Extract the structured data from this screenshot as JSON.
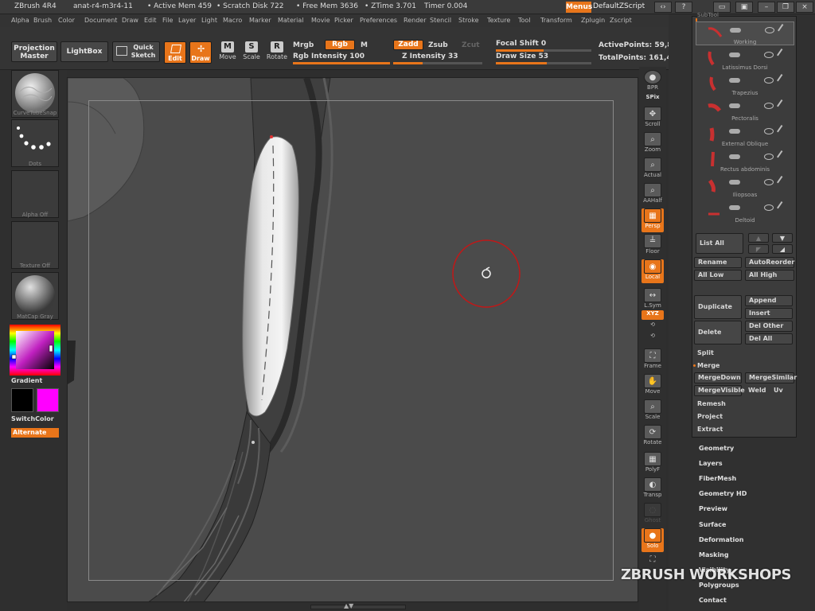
{
  "titlebar": {
    "app": "ZBrush 4R4",
    "doc": "anat-r4-m3r4-11",
    "active_mem": "• Active Mem 459",
    "scratch": "• Scratch Disk 722",
    "free_mem": "• Free Mem 3636",
    "ztime": "• ZTime 3.701",
    "timer": "Timer 0.004",
    "menus": "Menus",
    "zscript": "DefaultZScript"
  },
  "menu": [
    "Alpha",
    "Brush",
    "Color",
    "Document",
    "Draw",
    "Edit",
    "File",
    "Layer",
    "Light",
    "Macro",
    "Marker",
    "Material",
    "Movie",
    "Picker",
    "Preferences",
    "Render",
    "Stencil",
    "Stroke",
    "Texture",
    "Tool",
    "Transform",
    "Zplugin",
    "Zscript"
  ],
  "toolbar": {
    "projection_master": "Projection Master",
    "lightbox": "LightBox",
    "quick_sketch": "Quick Sketch",
    "edit": "Edit",
    "draw": "Draw",
    "move": "Move",
    "scale": "Scale",
    "rotate": "Rotate",
    "mrgb": "Mrgb",
    "rgb": "Rgb",
    "m": "M",
    "rgb_intensity": "Rgb Intensity 100",
    "rgb_intensity_value": 100,
    "zadd": "Zadd",
    "zsub": "Zsub",
    "zcut": "Zcut",
    "z_intensity": "Z Intensity 33",
    "z_intensity_value": 33,
    "focal_shift": "Focal Shift 0",
    "focal_shift_value": 0,
    "draw_size": "Draw Size 53",
    "draw_size_value": 53,
    "active_points": "ActivePoints: 59,8",
    "total_points": "TotalPoints: 161,4"
  },
  "left": {
    "brush_caption": "CurveTubeSnap",
    "stroke_caption": "Dots",
    "alpha_caption": "Alpha Off",
    "texture_caption": "Texture Off",
    "material_caption": "MatCap Gray",
    "gradient": "Gradient",
    "switch_color": "SwitchColor",
    "alternate": "Alternate",
    "main_color": "#000000",
    "secondary_color": "#ff00ff"
  },
  "right_shelf": [
    "BPR",
    "SPix",
    "Scroll",
    "Zoom",
    "Actual",
    "AAHalf",
    "Persp",
    "Floor",
    "Local",
    "L.Sym",
    "XYZ",
    "Frame",
    "Move",
    "Scale",
    "Rotate",
    "PolyF",
    "Transp",
    "Ghost",
    "Solo"
  ],
  "subtool": {
    "header": "SubTool",
    "items": [
      "Working",
      "Latissimus Dorsi",
      "Trapezius",
      "Pectoralis",
      "External Oblique",
      "Rectus abdominis",
      "Iliopsoas",
      "Deltoid"
    ],
    "list_all": "List All",
    "rename": "Rename",
    "auto_reorder": "AutoReorder",
    "all_low": "All Low",
    "all_high": "All High",
    "append": "Append",
    "duplicate": "Duplicate",
    "insert": "Insert",
    "delete": "Delete",
    "del_other": "Del Other",
    "del_all": "Del All",
    "split": "Split",
    "merge": "Merge",
    "merge_down": "MergeDown",
    "merge_similar": "MergeSimilar",
    "merge_visible": "MergeVisible",
    "weld": "Weld",
    "uv": "Uv",
    "remesh": "Remesh",
    "project": "Project",
    "extract": "Extract"
  },
  "sections": [
    "Geometry",
    "Layers",
    "FiberMesh",
    "Geometry HD",
    "Preview",
    "Surface",
    "Deformation",
    "Masking",
    "Visibility",
    "Polygroups",
    "Contact"
  ],
  "watermark": "ZBRUSH WORKSHOPS"
}
